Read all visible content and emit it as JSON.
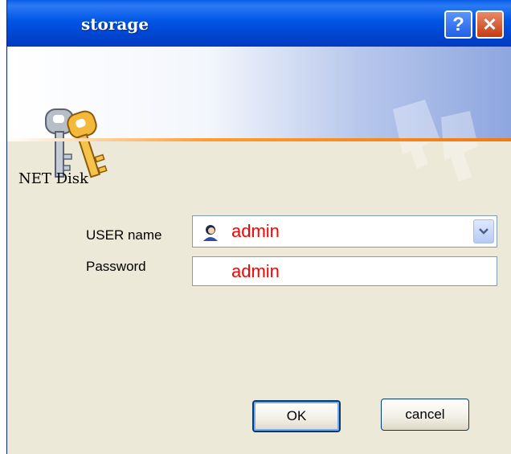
{
  "window": {
    "title": "storage"
  },
  "titlebar": {
    "help_glyph": "?",
    "close_glyph": "✕"
  },
  "icons": {
    "banner": "keys-icon",
    "user": "user-icon",
    "dropdown": "chevron-down-icon"
  },
  "form": {
    "section": "NET Disk",
    "user_label": "USER name",
    "user_value": "admin",
    "password_label": "Password",
    "password_value": "admin"
  },
  "buttons": {
    "ok": "OK",
    "cancel": "cancel"
  },
  "colors": {
    "title_bar": "#0055e5",
    "value_text": "#ff0000",
    "dialog_bg": "#ece9d8"
  }
}
